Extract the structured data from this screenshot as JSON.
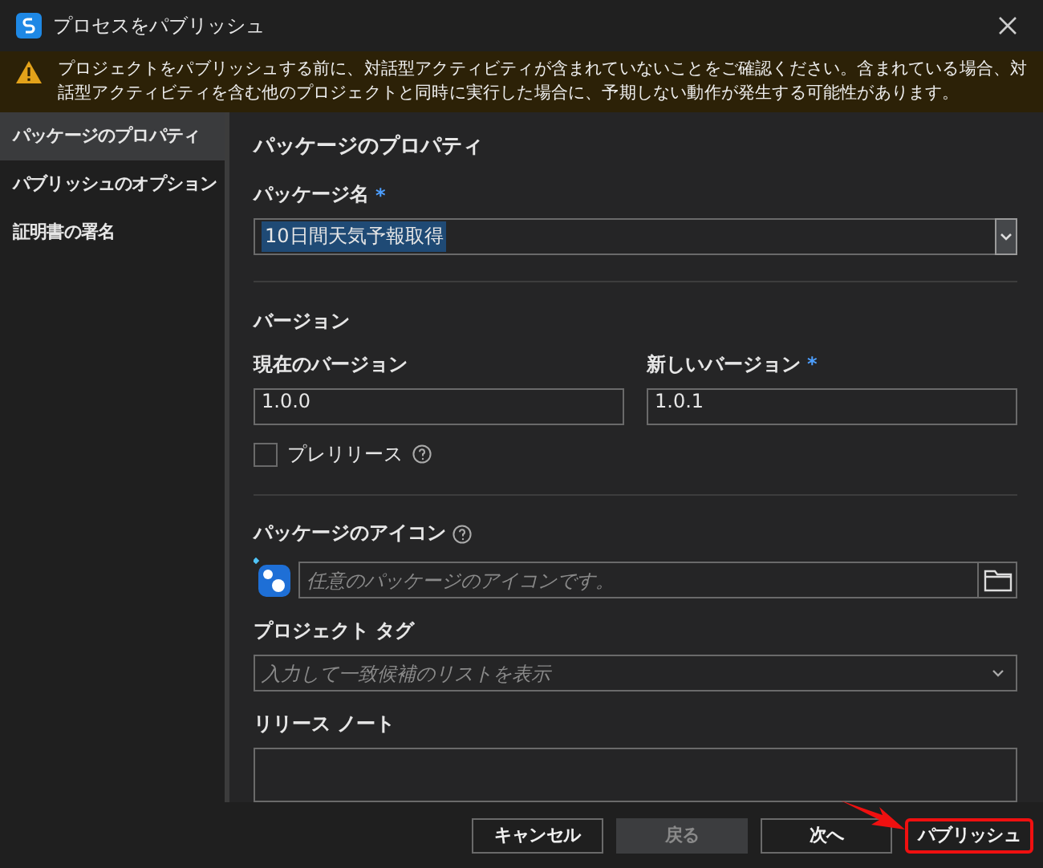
{
  "window": {
    "title": "プロセスをパブリッシュ"
  },
  "warning": {
    "text": "プロジェクトをパブリッシュする前に、対話型アクティビティが含まれていないことをご確認ください。含まれている場合、対話型アクティビティを含む他のプロジェクトと同時に実行した場合に、予期しない動作が発生する可能性があります。"
  },
  "sidebar": {
    "items": [
      {
        "label": "パッケージのプロパティ",
        "selected": true
      },
      {
        "label": "パブリッシュのオプション",
        "selected": false
      },
      {
        "label": "証明書の署名",
        "selected": false
      }
    ]
  },
  "panel": {
    "title": "パッケージのプロパティ",
    "package_name": {
      "label": "パッケージ名",
      "required_mark": "*",
      "value": "10日間天気予報取得",
      "text_selected": true
    },
    "version": {
      "heading": "バージョン",
      "current": {
        "label": "現在のバージョン",
        "value": "1.0.0"
      },
      "new": {
        "label": "新しいバージョン",
        "required_mark": "*",
        "value": "1.0.1"
      },
      "prerelease": {
        "label": "プレリリース",
        "checked": false
      }
    },
    "package_icon": {
      "label": "パッケージのアイコン",
      "placeholder": "任意のパッケージのアイコンです。"
    },
    "project_tags": {
      "label": "プロジェクト タグ",
      "placeholder": "入力して一致候補のリストを表示"
    },
    "release_notes": {
      "label": "リリース ノート"
    }
  },
  "buttons": [
    {
      "label": "キャンセル",
      "disabled": false,
      "highlighted": false
    },
    {
      "label": "戻る",
      "disabled": true,
      "highlighted": false
    },
    {
      "label": "次へ",
      "disabled": false,
      "highlighted": false
    },
    {
      "label": "パブリッシュ",
      "disabled": false,
      "highlighted": true
    }
  ]
}
